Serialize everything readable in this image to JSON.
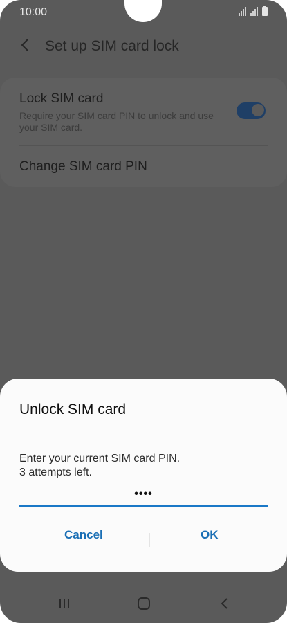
{
  "status_bar": {
    "time": "10:00"
  },
  "header": {
    "title": "Set up SIM card lock"
  },
  "settings": {
    "lock_sim": {
      "title": "Lock SIM card",
      "description": "Require your SIM card PIN to unlock and use your SIM card.",
      "enabled": true
    },
    "change_pin": {
      "title": "Change SIM card PIN"
    }
  },
  "dialog": {
    "title": "Unlock SIM card",
    "message_line1": "Enter your current SIM card PIN.",
    "message_line2": "3 attempts left.",
    "pin_value": "••••",
    "cancel_label": "Cancel",
    "ok_label": "OK"
  },
  "colors": {
    "accent": "#1a78c7",
    "toggle_on": "#1f3f66"
  },
  "navbar": {
    "icons": [
      "recent-apps-icon",
      "home-icon",
      "back-icon"
    ]
  }
}
